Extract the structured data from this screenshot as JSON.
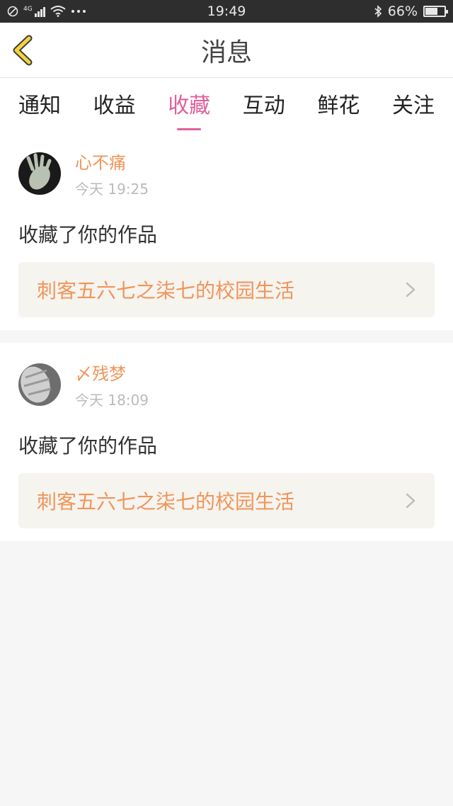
{
  "status_bar": {
    "time": "19:49",
    "signal_label": "4G",
    "battery_percent": "66%",
    "battery_level": 0.66
  },
  "navbar": {
    "title": "消息",
    "back_icon": "chevron-left-icon"
  },
  "tabs": [
    {
      "label": "通知",
      "active": false
    },
    {
      "label": "收益",
      "active": false
    },
    {
      "label": "收藏",
      "active": true
    },
    {
      "label": "互动",
      "active": false
    },
    {
      "label": "鲜花",
      "active": false
    },
    {
      "label": "关注",
      "active": false
    }
  ],
  "messages": [
    {
      "username": "心不痛",
      "time": "今天 19:25",
      "action": "收藏了你的作品",
      "work_title": "刺客五六七之柒七的校园生活"
    },
    {
      "username": "〆残梦",
      "time": "今天 18:09",
      "action": "收藏了你的作品",
      "work_title": "刺客五六七之柒七的校园生活"
    }
  ],
  "colors": {
    "accent_pink": "#e0609a",
    "username_orange": "#f0955a",
    "back_icon_yellow": "#f3d33c"
  }
}
